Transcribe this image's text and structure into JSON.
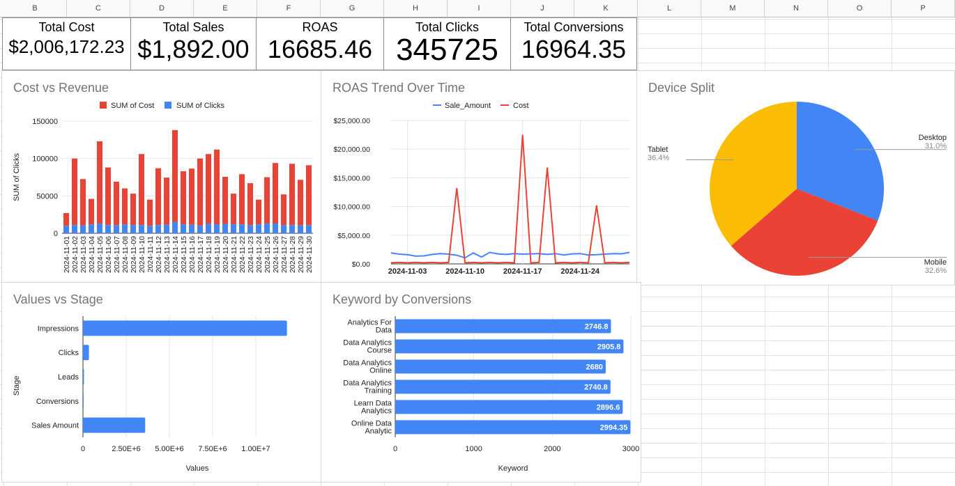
{
  "columns": [
    {
      "id": "B",
      "x": 5,
      "w": 91
    },
    {
      "id": "C",
      "x": 96,
      "w": 91
    },
    {
      "id": "D",
      "x": 187,
      "w": 91
    },
    {
      "id": "E",
      "x": 278,
      "w": 91
    },
    {
      "id": "F",
      "x": 369,
      "w": 91
    },
    {
      "id": "G",
      "x": 460,
      "w": 91
    },
    {
      "id": "H",
      "x": 551,
      "w": 91
    },
    {
      "id": "I",
      "x": 642,
      "w": 91
    },
    {
      "id": "J",
      "x": 733,
      "w": 91
    },
    {
      "id": "K",
      "x": 824,
      "w": 91
    },
    {
      "id": "L",
      "x": 915,
      "w": 91
    },
    {
      "id": "M",
      "x": 1006,
      "w": 91
    },
    {
      "id": "N",
      "x": 1097,
      "w": 91
    },
    {
      "id": "O",
      "x": 1188,
      "w": 91
    },
    {
      "id": "P",
      "x": 1279,
      "w": 91
    }
  ],
  "kpis": [
    {
      "label": "Total Cost",
      "value": "$2,006,172.23"
    },
    {
      "label": "Total Sales",
      "value": "$1,892.00"
    },
    {
      "label": "ROAS",
      "value": "16685.46"
    },
    {
      "label": "Total Clicks",
      "value": "345725"
    },
    {
      "label": "Total Conversions",
      "value": "16964.35"
    }
  ],
  "charts": {
    "cost_vs_revenue": {
      "title": "Cost vs Revenue",
      "legend": [
        "SUM of Cost",
        "SUM of Clicks"
      ],
      "ylabel": "SUM of Clicks"
    },
    "roas_trend": {
      "title": "ROAS Trend Over Time",
      "legend": [
        "Sale_Amount",
        "Cost"
      ]
    },
    "device_split": {
      "title": "Device Split"
    },
    "values_vs_stage": {
      "title": "Values vs Stage",
      "xlabel": "Values",
      "ylabel": "Stage"
    },
    "keyword_conv": {
      "title": "Keyword by Conversions",
      "xlabel": "Keyword"
    }
  },
  "chart_data": [
    {
      "type": "bar",
      "stacked": true,
      "title": "Cost vs Revenue",
      "ylabel": "SUM of Clicks",
      "ylim": [
        0,
        150000
      ],
      "yticks": [
        "0",
        "50000",
        "100000",
        "150000"
      ],
      "categories": [
        "2024-11-01",
        "2024-11-02",
        "2024-11-03",
        "2024-11-04",
        "2024-11-05",
        "2024-11-06",
        "2024-11-07",
        "2024-11-08",
        "2024-11-09",
        "2024-11-10",
        "2024-11-11",
        "2024-11-12",
        "2024-11-13",
        "2024-11-14",
        "2024-11-15",
        "2024-11-16",
        "2024-11-17",
        "2024-11-18",
        "2024-11-19",
        "2024-11-20",
        "2024-11-21",
        "2024-11-22",
        "2024-11-23",
        "2024-11-24",
        "2024-11-25",
        "2024-11-26",
        "2024-11-27",
        "2024-11-28",
        "2024-11-29",
        "2024-11-30"
      ],
      "series": [
        {
          "name": "SUM of Clicks",
          "color": "#4285f4",
          "values": [
            10000,
            11000,
            10500,
            12000,
            13000,
            11000,
            11000,
            12000,
            11000,
            11000,
            10000,
            11000,
            11500,
            15000,
            12000,
            11500,
            10000,
            13000,
            12000,
            12500,
            12000,
            12000,
            11000,
            12000,
            13000,
            13000,
            11000,
            11000,
            10500,
            11000
          ]
        },
        {
          "name": "SUM of Cost",
          "color": "#ea4335",
          "values": [
            17000,
            89000,
            62000,
            34000,
            110000,
            77000,
            58000,
            48000,
            42000,
            95000,
            35000,
            76000,
            63000,
            123000,
            71000,
            75000,
            90000,
            93000,
            100000,
            63000,
            41000,
            67000,
            56000,
            33000,
            62000,
            81000,
            41000,
            82000,
            61000,
            80000
          ]
        }
      ]
    },
    {
      "type": "line",
      "title": "ROAS Trend Over Time",
      "ylim": [
        0,
        25000
      ],
      "yticks": [
        "$0.00",
        "$5,000.00",
        "$10,000.00",
        "$15,000.00",
        "$20,000.00",
        "$25,000.00"
      ],
      "xticks": [
        "2024-11-03",
        "2024-11-10",
        "2024-11-17",
        "2024-11-24"
      ],
      "series": [
        {
          "name": "Sale_Amount",
          "color": "#4285f4",
          "values": [
            1900,
            1700,
            1600,
            1350,
            1400,
            1650,
            1800,
            1700,
            1500,
            1050,
            1900,
            1200,
            2000,
            1750,
            1650,
            1800,
            1700,
            1750,
            1800,
            1650,
            1800,
            1550,
            1750,
            1800,
            1550,
            1600,
            1700,
            1800,
            1750,
            2000
          ]
        },
        {
          "name": "Cost",
          "color": "#ea4335",
          "values": [
            200,
            250,
            200,
            250,
            200,
            250,
            200,
            250,
            13200,
            200,
            250,
            200,
            250,
            200,
            250,
            200,
            22500,
            200,
            250,
            16800,
            200,
            250,
            200,
            250,
            200,
            10200,
            200,
            250,
            200,
            250
          ]
        }
      ]
    },
    {
      "type": "pie",
      "title": "Device Split",
      "slices": [
        {
          "label": "Desktop",
          "value": 31.0,
          "pct": "31.0%",
          "color": "#4285f4"
        },
        {
          "label": "Mobile",
          "value": 32.6,
          "pct": "32.6%",
          "color": "#ea4335"
        },
        {
          "label": "Tablet",
          "value": 36.4,
          "pct": "36.4%",
          "color": "#fbbc04"
        }
      ]
    },
    {
      "type": "bar",
      "orientation": "horizontal",
      "title": "Values vs Stage",
      "xlabel": "Values",
      "ylabel": "Stage",
      "xlim": [
        0,
        12500000
      ],
      "xticks": [
        {
          "v": 0,
          "t": "0"
        },
        {
          "v": 2500000,
          "t": "2.50E+6"
        },
        {
          "v": 5000000,
          "t": "5.00E+6"
        },
        {
          "v": 7500000,
          "t": "7.50E+6"
        },
        {
          "v": 10000000,
          "t": "1.00E+7"
        }
      ],
      "categories": [
        "Impressions",
        "Clicks",
        "Leads",
        "Conversions",
        "Sales Amount"
      ],
      "values": [
        11800000,
        345725,
        60000,
        16964,
        3600000
      ]
    },
    {
      "type": "bar",
      "orientation": "horizontal",
      "title": "Keyword by Conversions",
      "xlabel": "Keyword",
      "xlim": [
        0,
        3000
      ],
      "xticks": [
        {
          "v": 0,
          "t": "0"
        },
        {
          "v": 1000,
          "t": "1000"
        },
        {
          "v": 2000,
          "t": "2000"
        },
        {
          "v": 3000,
          "t": "3000"
        }
      ],
      "categories": [
        [
          "Analytics For",
          "Data"
        ],
        [
          "Data Analytics",
          "Course"
        ],
        [
          "Data Analytics",
          "Online"
        ],
        [
          "Data Analytics",
          "Training"
        ],
        [
          "Learn Data",
          "Analytics"
        ],
        [
          "Online Data",
          "Analytic"
        ]
      ],
      "values": [
        2746.8,
        2905.8,
        2680,
        2740.8,
        2896.6,
        2994.35
      ],
      "labels": [
        "2746.8",
        "2905.8",
        "2680",
        "2740.8",
        "2896.6",
        "2994.35"
      ]
    }
  ]
}
